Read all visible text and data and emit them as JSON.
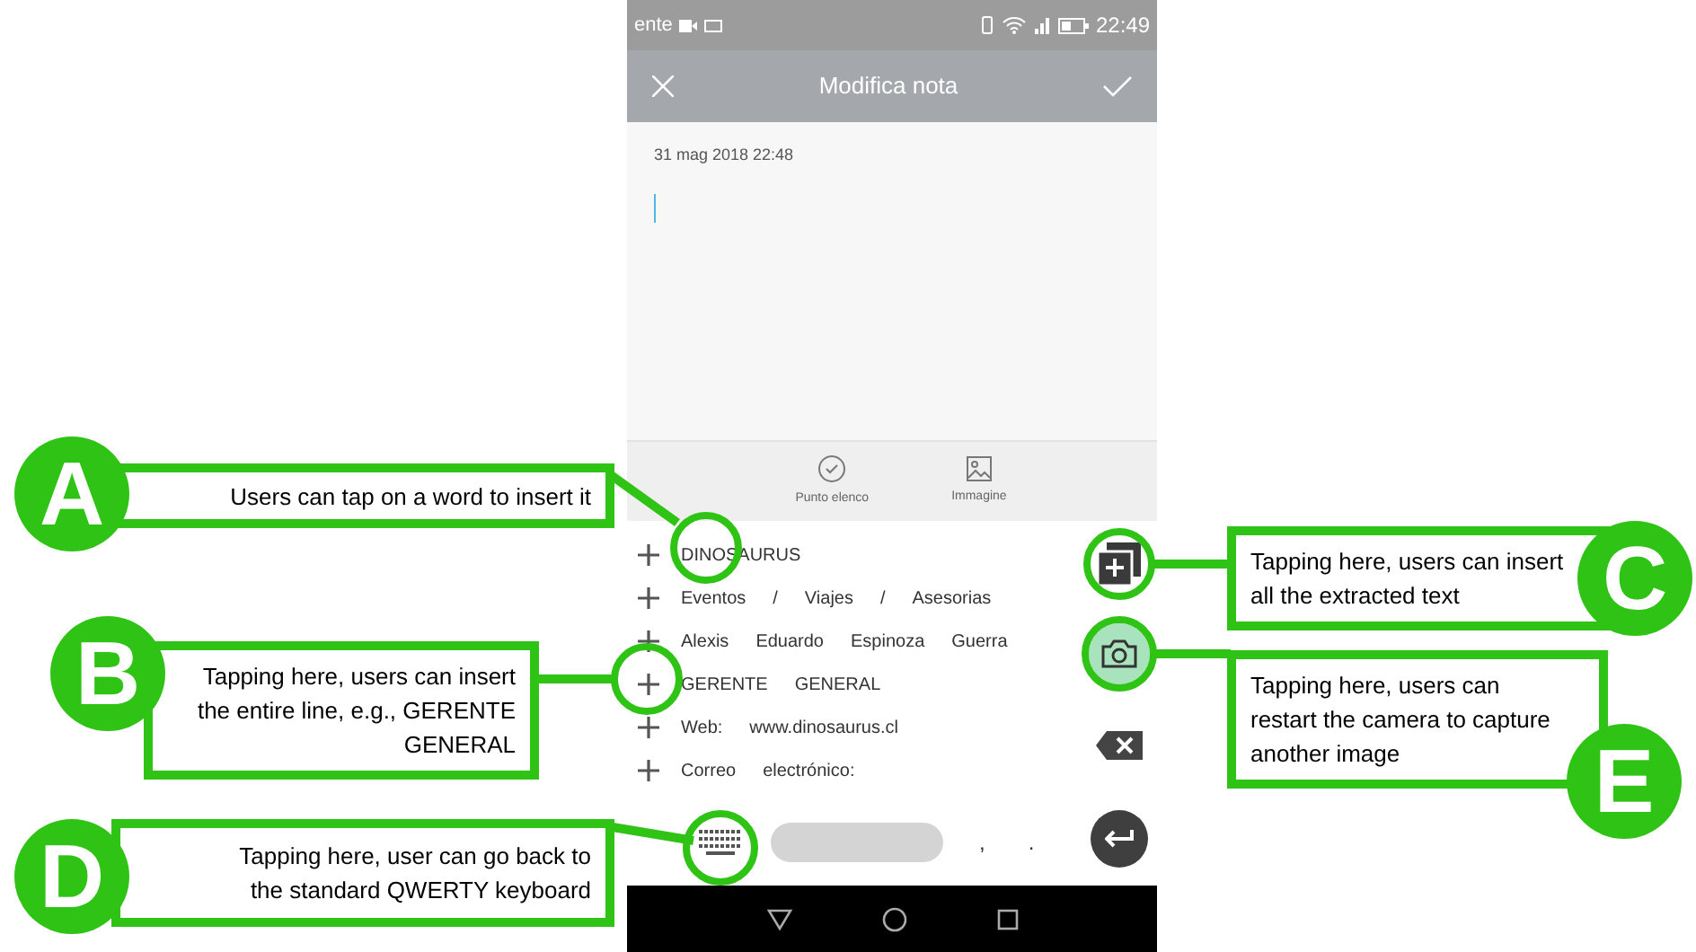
{
  "status_bar": {
    "carrier": "ente",
    "time": "22:49"
  },
  "toolbar": {
    "title": "Modifica nota"
  },
  "note": {
    "date": "31 mag 2018 22:48"
  },
  "format_bar": [
    {
      "kind": "bullet",
      "label": "Punto elenco"
    },
    {
      "kind": "image",
      "label": "Immagine"
    }
  ],
  "extracted_lines": [
    {
      "words": [
        "DINOSAURUS"
      ]
    },
    {
      "words": [
        "Eventos",
        "/",
        "Viajes",
        "/",
        "Asesorias"
      ]
    },
    {
      "words": [
        "Alexis",
        "Eduardo",
        "Espinoza",
        "Guerra"
      ]
    },
    {
      "words": [
        "GERENTE",
        "GENERAL"
      ]
    },
    {
      "words": [
        "Web:",
        "www.dinosaurus.cl"
      ]
    },
    {
      "words": [
        "Correo",
        "electrónico:"
      ]
    }
  ],
  "keyboard_row": {
    "keys": [
      ",",
      "."
    ]
  },
  "callouts": [
    {
      "letter": "A",
      "text": "Users can tap on a word to insert it"
    },
    {
      "letter": "B",
      "text": "Tapping here, users can insert the entire line, e.g., GERENTE GENERAL"
    },
    {
      "letter": "C",
      "text": "Tapping here, users can insert all the extracted text"
    },
    {
      "letter": "D",
      "text": "Tapping here, user can go back to the standard QWERTY keyboard"
    },
    {
      "letter": "E",
      "text": "Tapping here, users can restart the camera to capture another image"
    }
  ]
}
